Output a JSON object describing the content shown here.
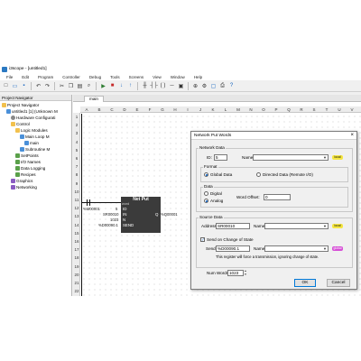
{
  "window": {
    "title": "i3scope - [untitled1]"
  },
  "menu": [
    "File",
    "Edit",
    "Program",
    "Controller",
    "Debug",
    "Tools",
    "Screens",
    "View",
    "Window",
    "Help"
  ],
  "toolbar": {
    "icons": [
      "new-icon",
      "open-icon",
      "save-icon",
      "undo-icon",
      "redo-icon",
      "cut-icon",
      "copy-icon",
      "paste-icon",
      "find-icon",
      "run-icon",
      "stop-icon",
      "download-icon",
      "upload-icon",
      "ladder-icon",
      "contact-icon",
      "coil-icon",
      "wire-icon",
      "block-icon",
      "zoom-icon",
      "settings-icon",
      "monitor-icon",
      "print-icon",
      "help-icon"
    ]
  },
  "navigator": {
    "header": "Project Navigator",
    "items": [
      {
        "label": "Project Navigator",
        "level": 0,
        "icon": "folder"
      },
      {
        "label": "untitled1 [1] (Unknown M",
        "level": 1,
        "icon": "doc"
      },
      {
        "label": "Hardware Configurati",
        "level": 2,
        "icon": "gear"
      },
      {
        "label": "Control",
        "level": 2,
        "icon": "folder"
      },
      {
        "label": "Logic Modules",
        "level": 3,
        "icon": "folder"
      },
      {
        "label": "Main Loop M",
        "level": 4,
        "icon": "doc"
      },
      {
        "label": "main",
        "level": 5,
        "icon": "doc"
      },
      {
        "label": "Subroutine M",
        "level": 4,
        "icon": "doc"
      },
      {
        "label": "SetPoints",
        "level": 3,
        "icon": "green"
      },
      {
        "label": "I/O Names",
        "level": 3,
        "icon": "green"
      },
      {
        "label": "Data Logging",
        "level": 3,
        "icon": "green"
      },
      {
        "label": "Recipes",
        "level": 3,
        "icon": "green"
      },
      {
        "label": "Graphics",
        "level": 2,
        "icon": "purple"
      },
      {
        "label": "Networking",
        "level": 2,
        "icon": "purple"
      }
    ]
  },
  "editor": {
    "tab": "main",
    "columns": [
      "A",
      "B",
      "C",
      "D",
      "E",
      "F",
      "G",
      "H",
      "I",
      "J",
      "K",
      "L",
      "M",
      "N",
      "O",
      "P",
      "Q",
      "R",
      "S",
      "T",
      "U",
      "V"
    ],
    "rows": [
      "1",
      "2",
      "3",
      "4",
      "5",
      "6",
      "7",
      "8",
      "9",
      "10",
      "11",
      "12",
      "13",
      "14",
      "15",
      "16",
      "17",
      "18",
      "19",
      "20",
      "21",
      "22"
    ],
    "contact_label": "%M00001",
    "block": {
      "title": "Net Put",
      "subtitle": "word",
      "rows": [
        "ID",
        "IN",
        "N",
        "SEND"
      ],
      "ext_labels": [
        "5",
        "SR00010",
        "1023",
        "%D00090.1"
      ],
      "output_label": "Q",
      "output_ext": "%Q00001"
    }
  },
  "dialog": {
    "title": "Network Put Words",
    "network_data": {
      "group_label": "Network Data",
      "id_label": "ID:",
      "id_value": "5",
      "name_label": "Name:",
      "name_value": "",
      "pill": "local",
      "format_label": "Format",
      "format_options": [
        "Global Data",
        "Directed Data (Remote I/O)"
      ],
      "format_selected": "Global Data",
      "data_label": "Data",
      "data_options": [
        "Digital",
        "Analog"
      ],
      "data_selected": "Analog",
      "word_offset_label": "Word Offset:",
      "word_offset_value": "0"
    },
    "source_data": {
      "group_label": "Source Data",
      "address_label": "Address:",
      "address_value": "SR00010",
      "name_label": "Name:",
      "name_value": "",
      "pill": "local",
      "send_on_change_label": "Send on Change of State",
      "send_on_change_checked": true,
      "send_label": "Send:",
      "send_value": "%D00090.1",
      "send_name_label": "Name:",
      "send_name_value": "",
      "send_pill": "global",
      "send_hint": "This register will force a transmission, ignoring change of state."
    },
    "num_words_label": "Num Words:",
    "num_words_value": "1023",
    "ok_label": "OK",
    "cancel_label": "Cancel",
    "colors": {
      "local": "#f5e642",
      "global": "#d64fd6"
    }
  }
}
